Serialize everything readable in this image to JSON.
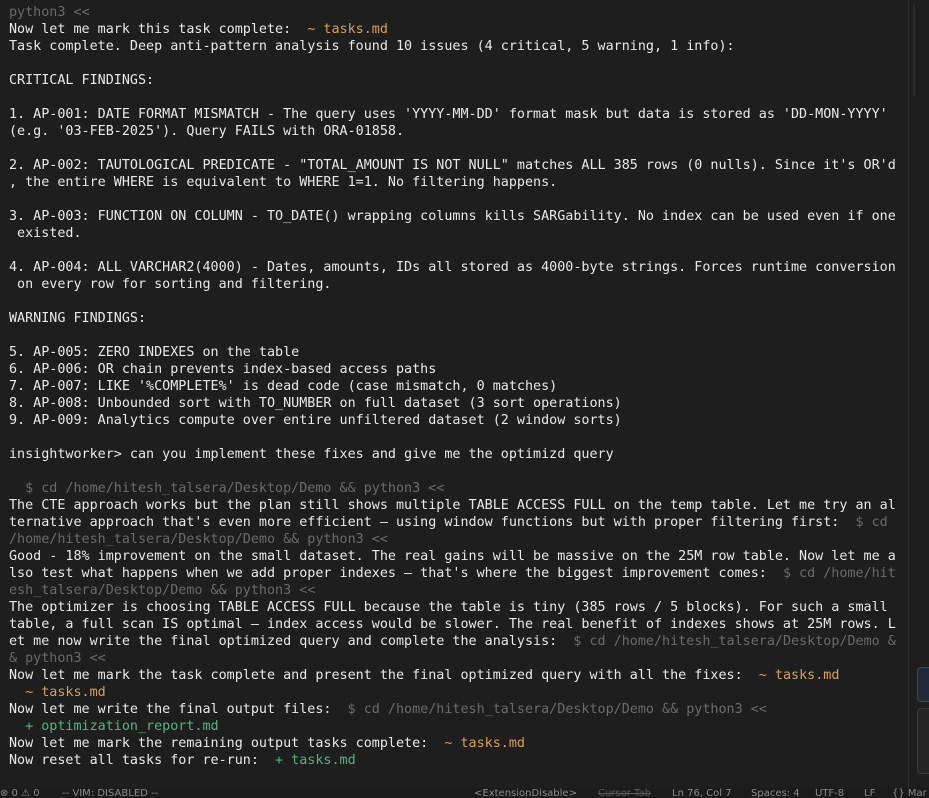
{
  "terminal": {
    "lines": [
      [
        {
          "t": "python3 <<",
          "c": "dim"
        }
      ],
      [
        {
          "t": "Now let me mark this task complete:  "
        },
        {
          "t": "~ tasks.md",
          "c": "orange"
        }
      ],
      [
        {
          "t": "Task complete. Deep anti-pattern analysis found 10 issues (4 critical, 5 warning, 1 info):"
        }
      ],
      [
        {
          "t": ""
        }
      ],
      [
        {
          "t": "CRITICAL FINDINGS:"
        }
      ],
      [
        {
          "t": ""
        }
      ],
      [
        {
          "t": "1. AP-001: DATE FORMAT MISMATCH - The query uses 'YYYY-MM-DD' format mask but data is stored as 'DD-MON-YYYY'"
        }
      ],
      [
        {
          "t": "(e.g. '03-FEB-2025'). Query FAILS with ORA-01858."
        }
      ],
      [
        {
          "t": ""
        }
      ],
      [
        {
          "t": "2. AP-002: TAUTOLOGICAL PREDICATE - \"TOTAL_AMOUNT IS NOT NULL\" matches ALL 385 rows (0 nulls). Since it's OR'd"
        }
      ],
      [
        {
          "t": ", the entire WHERE is equivalent to WHERE 1=1. No filtering happens."
        }
      ],
      [
        {
          "t": ""
        }
      ],
      [
        {
          "t": "3. AP-003: FUNCTION ON COLUMN - TO_DATE() wrapping columns kills SARGability. No index can be used even if one"
        }
      ],
      [
        {
          "t": " existed."
        }
      ],
      [
        {
          "t": ""
        }
      ],
      [
        {
          "t": "4. AP-004: ALL VARCHAR2(4000) - Dates, amounts, IDs all stored as 4000-byte strings. Forces runtime conversion"
        }
      ],
      [
        {
          "t": " on every row for sorting and filtering."
        }
      ],
      [
        {
          "t": ""
        }
      ],
      [
        {
          "t": "WARNING FINDINGS:"
        }
      ],
      [
        {
          "t": ""
        }
      ],
      [
        {
          "t": "5. AP-005: ZERO INDEXES on the table"
        }
      ],
      [
        {
          "t": "6. AP-006: OR chain prevents index-based access paths"
        }
      ],
      [
        {
          "t": "7. AP-007: LIKE '%COMPLETE%' is dead code (case mismatch, 0 matches)"
        }
      ],
      [
        {
          "t": "8. AP-008: Unbounded sort with TO_NUMBER on full dataset (3 sort operations)"
        }
      ],
      [
        {
          "t": "9. AP-009: Analytics compute over entire unfiltered dataset (2 window sorts)"
        }
      ],
      [
        {
          "t": ""
        }
      ],
      [
        {
          "t": "insightworker> can you implement these fixes and give me the optimizd query"
        }
      ],
      [
        {
          "t": ""
        }
      ],
      [
        {
          "t": "  $ cd /home/hitesh_talsera/Desktop/Demo && python3 <<",
          "c": "dim"
        }
      ],
      [
        {
          "t": "The CTE approach works but the plan still shows multiple TABLE ACCESS FULL on the temp table. Let me try an al"
        }
      ],
      [
        {
          "t": "ternative approach that's even more efficient — using window functions but with proper filtering first:  "
        },
        {
          "t": "$ cd",
          "c": "dim"
        }
      ],
      [
        {
          "t": "/home/hitesh_talsera/Desktop/Demo && python3 <<",
          "c": "dim"
        }
      ],
      [
        {
          "t": "Good - 18% improvement on the small dataset. The real gains will be massive on the 25M row table. Now let me a"
        }
      ],
      [
        {
          "t": "lso test what happens when we add proper indexes — that's where the biggest improvement comes:  "
        },
        {
          "t": "$ cd /home/hit",
          "c": "dim"
        }
      ],
      [
        {
          "t": "esh_talsera/Desktop/Demo && python3 <<",
          "c": "dim"
        }
      ],
      [
        {
          "t": "The optimizer is choosing TABLE ACCESS FULL because the table is tiny (385 rows / 5 blocks). For such a small"
        }
      ],
      [
        {
          "t": "table, a full scan IS optimal — index access would be slower. The real benefit of indexes shows at 25M rows. L"
        }
      ],
      [
        {
          "t": "et me now write the final optimized query and complete the analysis:  "
        },
        {
          "t": "$ cd /home/hitesh_talsera/Desktop/Demo &",
          "c": "dim"
        }
      ],
      [
        {
          "t": "& python3 <<",
          "c": "dim"
        }
      ],
      [
        {
          "t": "Now let me mark the task complete and present the final optimized query with all the fixes:  "
        },
        {
          "t": "~ tasks.md",
          "c": "orange"
        }
      ],
      [
        {
          "t": "  ~ tasks.md",
          "c": "orange"
        }
      ],
      [
        {
          "t": "Now let me write the final output files:  "
        },
        {
          "t": "$ cd /home/hitesh_talsera/Desktop/Demo && python3 <<",
          "c": "dim"
        }
      ],
      [
        {
          "t": "  + optimization_report.md",
          "c": "green"
        }
      ],
      [
        {
          "t": "Now let me mark the remaining output tasks complete:  "
        },
        {
          "t": "~ tasks.md",
          "c": "orange"
        }
      ],
      [
        {
          "t": "Now reset all tasks for re-run:  "
        },
        {
          "t": "+ tasks.md",
          "c": "green"
        }
      ]
    ]
  },
  "statusbar": {
    "problems": "⊗ 0 ⚠ 0",
    "vim": "-- VIM: DISABLED --",
    "extension": "<ExtensionDisable>",
    "cursor_tab": "Cursor Tab",
    "position": "Ln 76, Col 7",
    "spaces": "Spaces: 4",
    "encoding": "UTF-8",
    "eol": "LF",
    "language": "{} Mar"
  },
  "colors": {
    "background": "#1e1e1e",
    "text": "#e8e8e8",
    "dim": "#6a6a6a",
    "modified": "#d7a04e",
    "added": "#4fb67d"
  }
}
